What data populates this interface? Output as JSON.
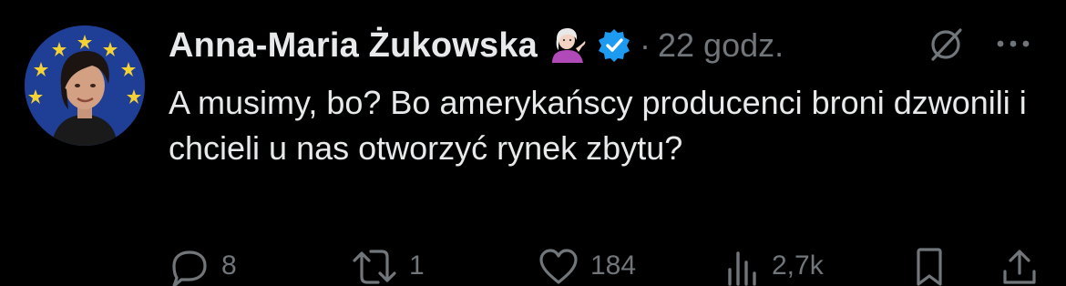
{
  "tweet": {
    "author": {
      "display_name": "Anna-Maria Żukowska",
      "avatar_icon": "profile-photo",
      "emoji_icon": "woman-tipping-hand-emoji",
      "verified_icon": "verified-badge-icon",
      "verified_color": "#1d9bf0"
    },
    "separator": "·",
    "timestamp": "22 godz.",
    "text": "A musimy, bo? Bo amerykańscy producenci broni dzwonili i chcieli u nas otworzyć rynek zbytu?",
    "actions": {
      "reply_count": "8",
      "retweet_count": "1",
      "like_count": "184",
      "views_count": "2,7k"
    }
  },
  "colors": {
    "background": "#000000",
    "text_primary": "#e7e9ea",
    "text_secondary": "#71767b"
  }
}
